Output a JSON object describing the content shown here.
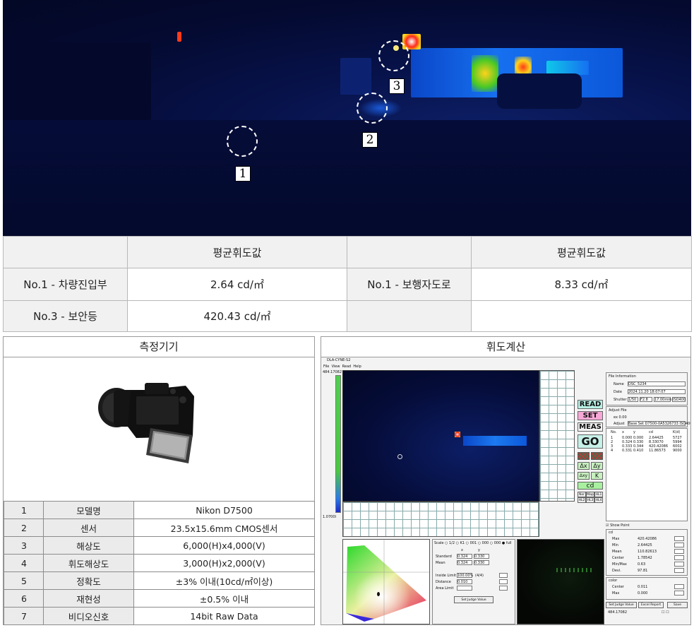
{
  "markers": [
    "1",
    "2",
    "3"
  ],
  "results": {
    "header": "평균휘도값",
    "rows": [
      [
        {
          "label": "No.1 - 차량진입부",
          "value": "2.64 cd/㎡"
        },
        {
          "label": "No.1 - 보행자도로",
          "value": "8.33 cd/㎡"
        }
      ],
      [
        {
          "label": "No.3 - 보안등",
          "value": "420.43 cd/㎡"
        },
        {
          "label": "",
          "value": ""
        }
      ]
    ]
  },
  "equipment": {
    "title": "측정기기",
    "specs": [
      {
        "num": "1",
        "key": "모델명",
        "value": "Nikon D7500"
      },
      {
        "num": "2",
        "key": "센서",
        "value": "23.5x15.6mm CMOS센서"
      },
      {
        "num": "3",
        "key": "해상도",
        "value": "6,000(H)x4,000(V)"
      },
      {
        "num": "4",
        "key": "휘도해상도",
        "value": "3,000(H)x2,000(V)"
      },
      {
        "num": "5",
        "key": "정확도",
        "value": "±3% 이내(10cd/㎡이상)"
      },
      {
        "num": "6",
        "key": "재현성",
        "value": "±0.5% 이내"
      },
      {
        "num": "7",
        "key": "비디오신호",
        "value": "14bit Raw Data"
      }
    ]
  },
  "calc": {
    "title": "휘도계산",
    "software": {
      "app_title": "DLA-CYNE-S2",
      "menu": [
        "File",
        "View",
        "Read",
        "Help"
      ],
      "scale_top": "484.17082",
      "scale_bottom": "1.0700I",
      "buttons": {
        "read": "READ",
        "set": "SET",
        "meas": "MEAS",
        "go": "GO",
        "cd": "cd"
      },
      "delta_buttons": [
        "Δx",
        "Δy",
        "Δxy",
        "K"
      ],
      "map_buttons": [
        "Nor",
        "Map",
        "HL1",
        "HL2",
        "HL3",
        "HL4"
      ],
      "file_info": {
        "title": "File Information",
        "name_label": "Name",
        "name": "DSC_5234",
        "date_label": "Date",
        "date": "2024.11.20 18:07:07",
        "shutter_label": "Shutter",
        "shutter": "1/50",
        "aperture": "F2.8",
        "focal": "17.00mm",
        "iso": "ISO400"
      },
      "adjust": {
        "title": "Adjust File",
        "k_label": "ex 0.00",
        "adjust_label": "Adjust",
        "adjust_value": "Base Set D7500-0A5326733 ISO400/F4"
      },
      "list_headers": [
        "No.",
        "x",
        "y",
        "cd",
        "K(d)"
      ],
      "list_rows": [
        [
          "1",
          "0.000",
          "0.000",
          "2.64425",
          "5727"
        ],
        [
          "2",
          "0.324",
          "0.330",
          "8.33070",
          "5994"
        ],
        [
          "3",
          "0.333",
          "0.344",
          "420.42086",
          "6002"
        ],
        [
          "4",
          "0.331",
          "0.410",
          "11.86573",
          "9000"
        ]
      ],
      "show_point": "Show Point",
      "cd_label": "cd",
      "stats": [
        {
          "label": "Max",
          "value": "420.42086"
        },
        {
          "label": "Min",
          "value": "2.64425"
        },
        {
          "label": "Mean",
          "value": "110.82613"
        },
        {
          "label": "Center",
          "value": "1.78542"
        },
        {
          "label": "Min/Max",
          "value": "0.63"
        },
        {
          "label": "Devi.",
          "value": "97.81"
        }
      ],
      "color_label": "color",
      "color_stats": [
        {
          "label": "Center",
          "value": "0.011"
        },
        {
          "label": "Max",
          "value": "0.000"
        }
      ],
      "bottom_buttons": [
        "Set Judge Value",
        "Excel Report",
        "Save"
      ],
      "status_value": "484.17082",
      "scale_options": "Scale ○ 1/2 ○ K1 ○ 001 ○ 000 ○ 000 ● full",
      "xy_headers": [
        "x",
        "y"
      ],
      "standard_label": "Standard",
      "standard_x": "0.324",
      "standard_y": "0.330",
      "mean_label": "Mean",
      "mean_x": "0.324",
      "mean_y": "0.330",
      "inside_label": "Inside Limit",
      "inside_value": "100.00%",
      "inside_unit": "(4/4)",
      "distance_label": "Distance",
      "distance_value": "0.010",
      "area_label": "Area Limit",
      "judge_button": "Set Judge Value"
    }
  },
  "colors": {
    "border": "#9a9a9a",
    "header_bg": "#f1f1f1",
    "read_btn": "#b8f0e4",
    "set_btn": "#f7a8d6",
    "go_btn": "#c6f0e8",
    "cd_btn": "#a8f0a0"
  }
}
